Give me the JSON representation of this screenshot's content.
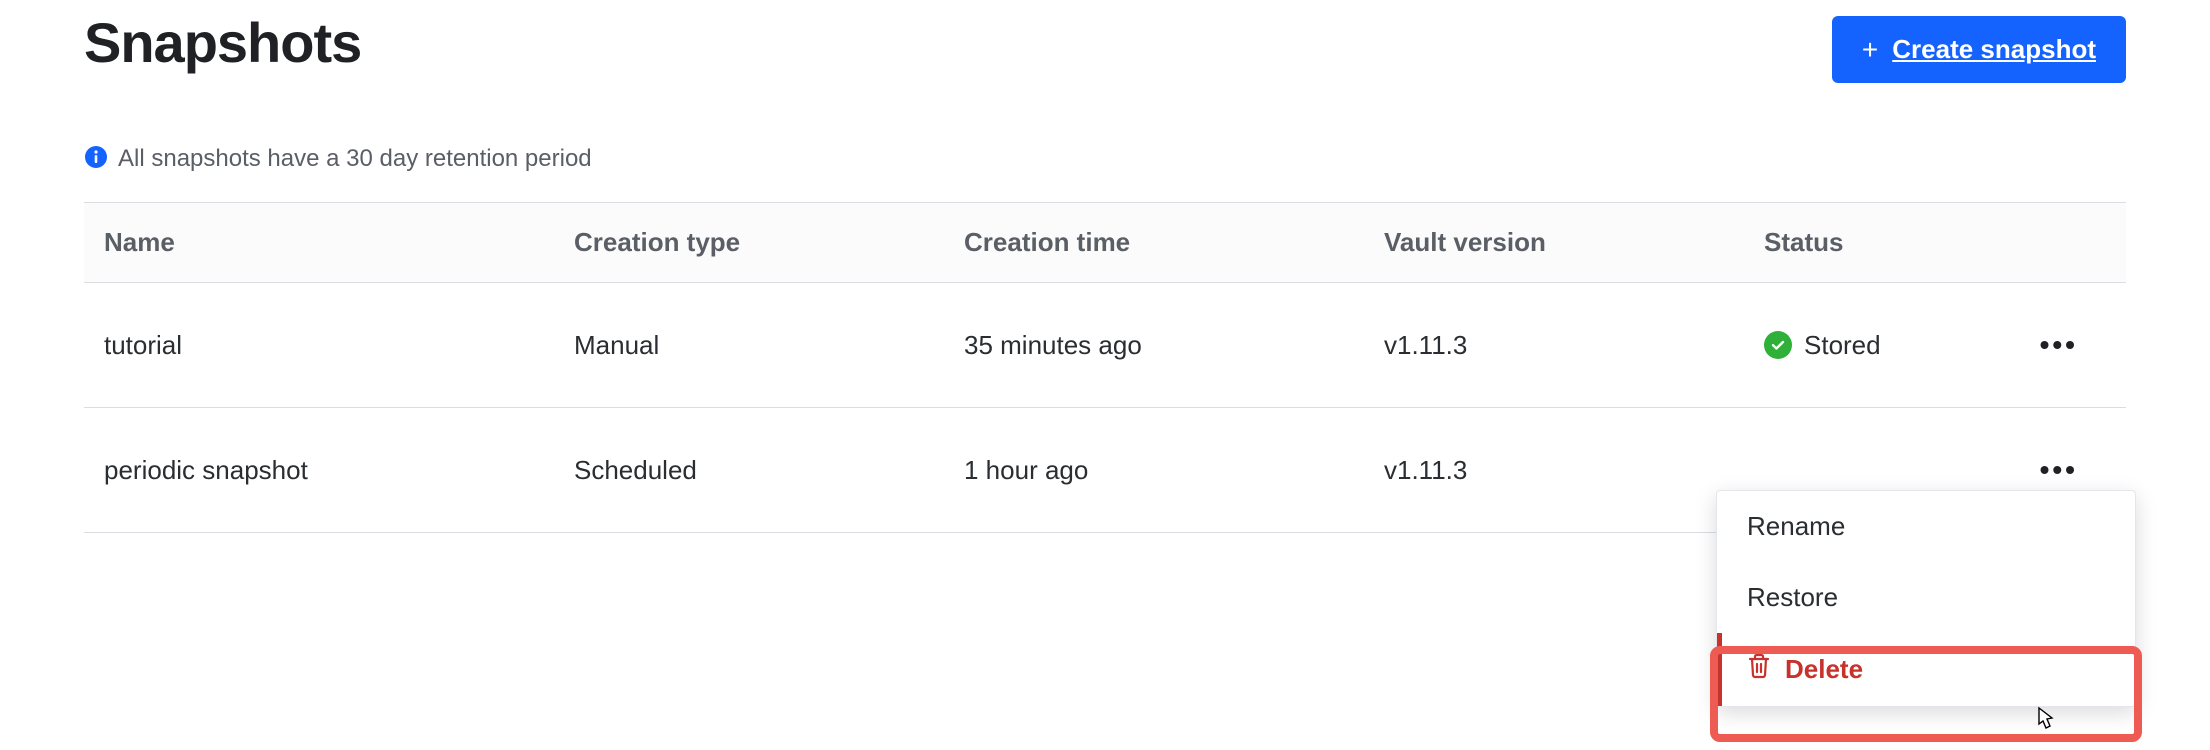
{
  "header": {
    "title": "Snapshots",
    "create_label": "Create snapshot"
  },
  "info": {
    "text": "All snapshots have a 30 day retention period"
  },
  "table": {
    "columns": {
      "name": "Name",
      "creation_type": "Creation type",
      "creation_time": "Creation time",
      "vault_version": "Vault version",
      "status": "Status"
    },
    "rows": [
      {
        "name": "tutorial",
        "creation_type": "Manual",
        "creation_time": "35 minutes ago",
        "vault_version": "v1.11.3",
        "status": "Stored"
      },
      {
        "name": "periodic snapshot",
        "creation_type": "Scheduled",
        "creation_time": "1 hour ago",
        "vault_version": "v1.11.3",
        "status": ""
      }
    ]
  },
  "menu": {
    "rename": "Rename",
    "restore": "Restore",
    "delete": "Delete"
  }
}
